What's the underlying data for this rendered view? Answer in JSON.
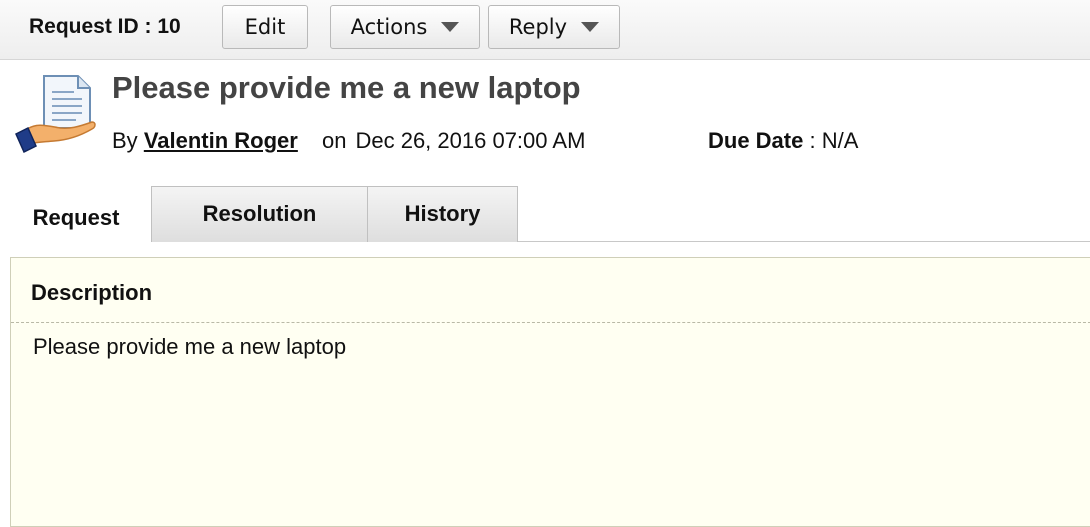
{
  "toolbar": {
    "request_id_label": "Request ID : 10",
    "edit_label": "Edit",
    "actions_label": "Actions",
    "reply_label": "Reply"
  },
  "header": {
    "icon": "request-document-hand-icon",
    "title": "Please provide me a new laptop",
    "by_label": "By",
    "author": "Valentin Roger",
    "on_label": "on",
    "date": "Dec 26, 2016 07:00 AM",
    "due_label": "Due Date",
    "due_value": ": N/A"
  },
  "tabs": [
    {
      "label": "Request",
      "active": true
    },
    {
      "label": "Resolution",
      "active": false
    },
    {
      "label": "History",
      "active": false
    }
  ],
  "panel": {
    "heading": "Description",
    "body": "Please provide me a new laptop"
  },
  "colors": {
    "panel_bg": "#fffff2",
    "title": "#444444"
  }
}
